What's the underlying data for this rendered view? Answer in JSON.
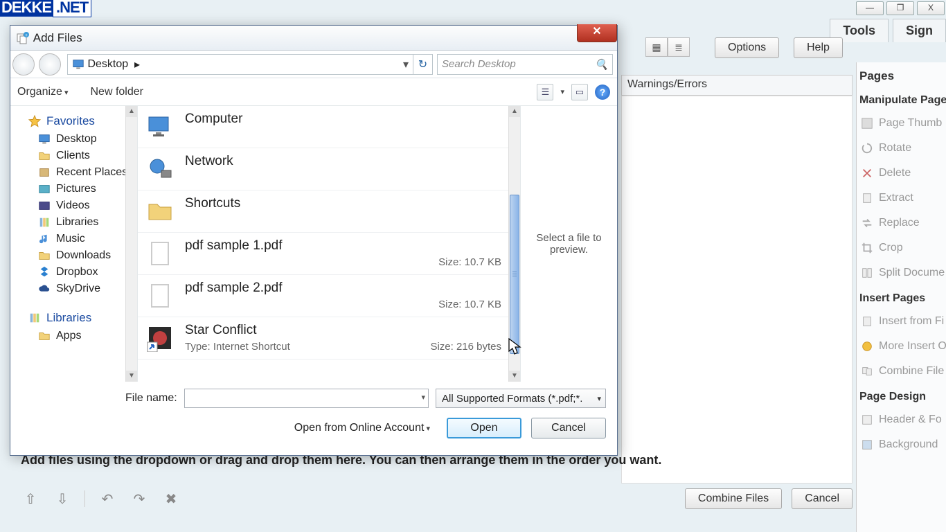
{
  "watermark": {
    "left": "DEKKE",
    "right": ".NET"
  },
  "titlebar": {
    "minimize": "—",
    "maximize": "❐",
    "close": "X"
  },
  "appTabs": {
    "tools": "Tools",
    "sign": "Sign"
  },
  "toolbar": {
    "options": "Options",
    "help": "Help"
  },
  "warningsHeader": "Warnings/Errors",
  "rightPane": {
    "pages": "Pages",
    "manipulate": "Manipulate Pages",
    "thumbnails": "Page Thumb",
    "rotate": "Rotate",
    "delete": "Delete",
    "extract": "Extract",
    "replace": "Replace",
    "crop": "Crop",
    "split": "Split Docume",
    "insert": "Insert Pages",
    "insertFromFile": "Insert from Fi",
    "moreInsert": "More Insert O",
    "combine": "Combine File",
    "pageDesign": "Page Design",
    "headerFooter": "Header & Fo",
    "background": "Background"
  },
  "combine": {
    "hint": "Add files using the dropdown or drag and drop them here. You can then arrange them in the order you want.",
    "combineFiles": "Combine Files",
    "cancel": "Cancel"
  },
  "dialog": {
    "title": "Add Files",
    "breadcrumb": "Desktop",
    "searchPlaceholder": "Search Desktop",
    "organize": "Organize",
    "newFolder": "New folder",
    "previewHint": "Select a file to preview.",
    "fileNameLabel": "File name:",
    "filter": "All Supported Formats (*.pdf;*.",
    "online": "Open from Online Account",
    "open": "Open",
    "cancel": "Cancel"
  },
  "tree": {
    "favorites": "Favorites",
    "desktop": "Desktop",
    "clients": "Clients",
    "recent": "Recent Places",
    "pictures": "Pictures",
    "videos": "Videos",
    "libraries": "Libraries",
    "music": "Music",
    "downloads": "Downloads",
    "dropbox": "Dropbox",
    "skydrive": "SkyDrive",
    "librariesGroup": "Libraries",
    "apps": "Apps"
  },
  "files": {
    "computer": "Computer",
    "network": "Network",
    "shortcuts": "Shortcuts",
    "pdf1": {
      "name": "pdf sample 1.pdf",
      "size": "Size: 10.7 KB"
    },
    "pdf2": {
      "name": "pdf sample 2.pdf",
      "size": "Size: 10.7 KB"
    },
    "star": {
      "name": "Star Conflict",
      "type": "Type: Internet Shortcut",
      "size": "Size: 216 bytes"
    }
  }
}
